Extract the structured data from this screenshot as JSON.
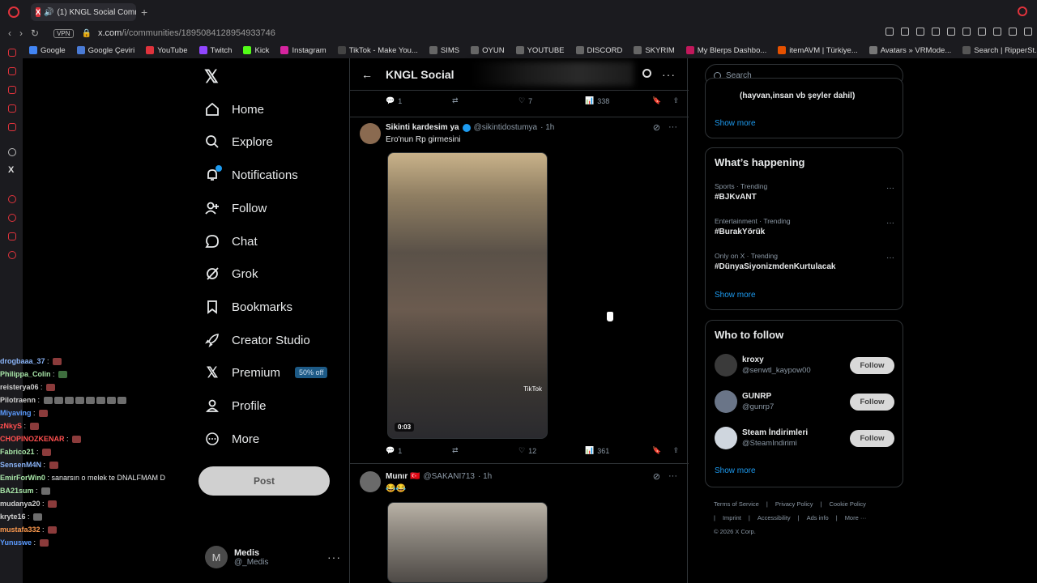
{
  "browser": {
    "tab_title": "(1) KNGL Social Comm",
    "url_main": "x.com",
    "url_rest": "/i/communities/1895084128954933746",
    "vpn_label": "VPN",
    "bookmarks": [
      {
        "label": "Google",
        "color": "#4285f4"
      },
      {
        "label": "Google Çeviri",
        "color": "#4a7bd6"
      },
      {
        "label": "YouTube",
        "color": "#e0333c"
      },
      {
        "label": "Twitch",
        "color": "#9146ff"
      },
      {
        "label": "Kick",
        "color": "#53fc18"
      },
      {
        "label": "Instagram",
        "color": "#d6249f"
      },
      {
        "label": "TikTok - Make You...",
        "color": "#444"
      },
      {
        "label": "SIMS",
        "color": "#666"
      },
      {
        "label": "OYUN",
        "color": "#666"
      },
      {
        "label": "YOUTUBE",
        "color": "#666"
      },
      {
        "label": "DISCORD",
        "color": "#666"
      },
      {
        "label": "SKYRIM",
        "color": "#666"
      },
      {
        "label": "My Blerps Dashbo...",
        "color": "#c2185b"
      },
      {
        "label": "itemAVM | Türkiye...",
        "color": "#e65100"
      },
      {
        "label": "Avatars » VRMode...",
        "color": "#777"
      },
      {
        "label": "Search | RipperSt...",
        "color": "#555"
      }
    ]
  },
  "chat": [
    {
      "user": "drogbaaa_37",
      "color": "#8ab4f8",
      "msg": "",
      "emotes": [
        "r"
      ]
    },
    {
      "user": "Philippa_Colin",
      "color": "#a8e6a8",
      "msg": "",
      "emotes": [
        "g"
      ]
    },
    {
      "user": "reisterya06",
      "color": "#cfcfcf",
      "msg": "",
      "emotes": [
        "r"
      ]
    },
    {
      "user": "Pilotraenn",
      "color": "#cfcfcf",
      "msg": "",
      "emotes": [
        "k",
        "k",
        "k",
        "k",
        "k",
        "k",
        "k",
        "k"
      ]
    },
    {
      "user": "Miyaving",
      "color": "#5b9bff",
      "msg": "",
      "emotes": [
        "r"
      ]
    },
    {
      "user": "zNkyS",
      "color": "#ff4f4f",
      "msg": "",
      "emotes": [
        "r"
      ]
    },
    {
      "user": "CHOPINOZKENAR",
      "color": "#ff4f4f",
      "msg": "",
      "emotes": [
        "r"
      ]
    },
    {
      "user": "Fabrico21",
      "color": "#a8e6a8",
      "msg": "",
      "emotes": [
        "r"
      ]
    },
    {
      "user": "SensenM4N",
      "color": "#8ab4f8",
      "msg": "",
      "emotes": [
        "r"
      ]
    },
    {
      "user": "EmirForWin0",
      "color": "#a8e6a8",
      "msg": "sanarsın o melek te DNALFMAM D",
      "emotes": []
    },
    {
      "user": "BA21sum",
      "color": "#a8e6a8",
      "msg": "",
      "emotes": [
        "k"
      ]
    },
    {
      "user": "mudanya20",
      "color": "#cfcfcf",
      "msg": "",
      "emotes": [
        "r"
      ]
    },
    {
      "user": "kryte16",
      "color": "#cfcfcf",
      "msg": "",
      "emotes": [
        "k"
      ]
    },
    {
      "user": "mustafa332",
      "color": "#ff9b4f",
      "msg": "",
      "emotes": [
        "r"
      ]
    },
    {
      "user": "Yunuswe",
      "color": "#5b9bff",
      "msg": "",
      "emotes": [
        "r"
      ]
    }
  ],
  "nav": {
    "items": [
      "Home",
      "Explore",
      "Notifications",
      "Follow",
      "Chat",
      "Grok",
      "Bookmarks",
      "Creator Studio",
      "Premium",
      "Profile",
      "More"
    ],
    "premium_badge": "50% off",
    "post_label": "Post",
    "account_initial": "M",
    "account_name": "Medis",
    "account_handle": "@_Medis"
  },
  "community": {
    "title": "KNGL Social"
  },
  "top_actions": {
    "replies": "1",
    "reposts": "",
    "likes": "7",
    "views": "338"
  },
  "tweets": [
    {
      "name": "Sikinti kardesim ya",
      "handle": "@sikintidostumya",
      "time": "· 1h",
      "text": "Ero'nun Rp girmesini",
      "video_time": "0:03",
      "video_watermark": "TikTok",
      "replies": "1",
      "reposts": "",
      "likes": "12",
      "views": "361"
    },
    {
      "name": "Munır 🇹🇷",
      "handle": "@SAKANI713",
      "time": "· 1h",
      "text": "😂😂"
    }
  ],
  "sidebar": {
    "search_placeholder": "Search",
    "top_box_text": "(hayvan,insan vb şeyler dahil)",
    "show_more": "Show more",
    "happening_title": "What’s happening",
    "trends": [
      {
        "meta": "Sports · Trending",
        "tag": "#BJKvANT"
      },
      {
        "meta": "Entertainment · Trending",
        "tag": "#BurakYörük"
      },
      {
        "meta": "Only on X · Trending",
        "tag": "#DünyaSiyonizmdenKurtulacak"
      }
    ],
    "wtf_title": "Who to follow",
    "follow_label": "Follow",
    "who_to_follow": [
      {
        "name": "kroxy",
        "handle": "@senwtl_kaypow00"
      },
      {
        "name": "GUNRP",
        "handle": "@gunrp7"
      },
      {
        "name": "Steam İndirimleri",
        "handle": "@SteamIndirimi"
      }
    ],
    "footer": [
      "Terms of Service",
      "|",
      "Privacy Policy",
      "|",
      "Cookie Policy",
      "|",
      "Imprint",
      "|",
      "Accessibility",
      "|",
      "Ads info",
      "|",
      "More ···",
      "© 2026 X Corp."
    ]
  }
}
